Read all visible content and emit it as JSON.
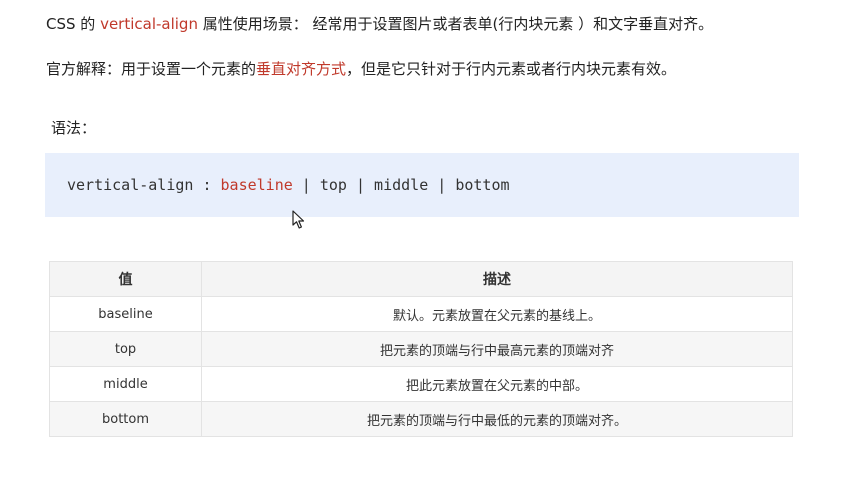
{
  "intro": {
    "line1_prefix": "CSS 的 ",
    "line1_keyword": "vertical-align",
    "line1_suffix": " 属性使用场景： 经常用于设置图片或者表单(行内块元素 ）和文字垂直对齐。",
    "line2_prefix": "官方解释：用于设置一个元素的",
    "line2_highlight": "垂直对齐方式",
    "line2_suffix": "，但是它只针对于行内元素或者行内块元素有效。"
  },
  "syntax": {
    "label": "语法：",
    "code_prefix": "vertical-align : ",
    "code_keyword": "baseline",
    "code_suffix": " | top | middle | bottom"
  },
  "table": {
    "headers": [
      "值",
      "描述"
    ],
    "rows": [
      [
        "baseline",
        "默认。元素放置在父元素的基线上。"
      ],
      [
        "top",
        "把元素的顶端与行中最高元素的顶端对齐"
      ],
      [
        "middle",
        "把此元素放置在父元素的中部。"
      ],
      [
        "bottom",
        "把元素的顶端与行中最低的元素的顶端对齐。"
      ]
    ]
  },
  "colors": {
    "keyword": "#c0392b",
    "code_background": "#e8effc",
    "table_header_background": "#f4f4f4",
    "table_border": "#e3e3e3"
  },
  "icons": {
    "cursor": "mouse-pointer-icon"
  }
}
